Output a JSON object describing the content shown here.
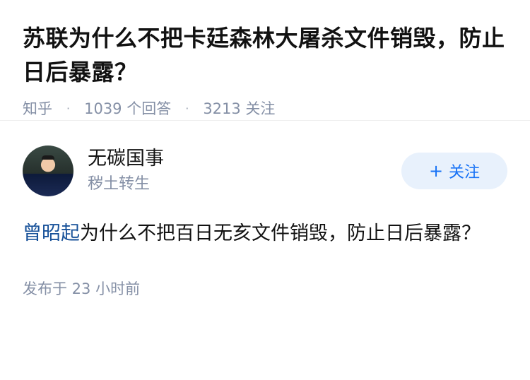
{
  "question": {
    "title": "苏联为什么不把卡廷森林大屠杀文件销毁，防止日后暴露？",
    "source": "知乎",
    "answers": "1039 个回答",
    "followers": "3213 关注"
  },
  "author": {
    "name": "无碳国事",
    "bio": "秽土转生",
    "follow_label": "关注",
    "follow_icon": "plus-icon"
  },
  "answer": {
    "mention": "曾昭起",
    "text": "为什么不把百日无亥文件销毁，防止日后暴露？",
    "time": "发布于 23 小时前"
  },
  "colors": {
    "accent": "#1772f6",
    "mention": "#175199",
    "meta": "#8590a6"
  }
}
